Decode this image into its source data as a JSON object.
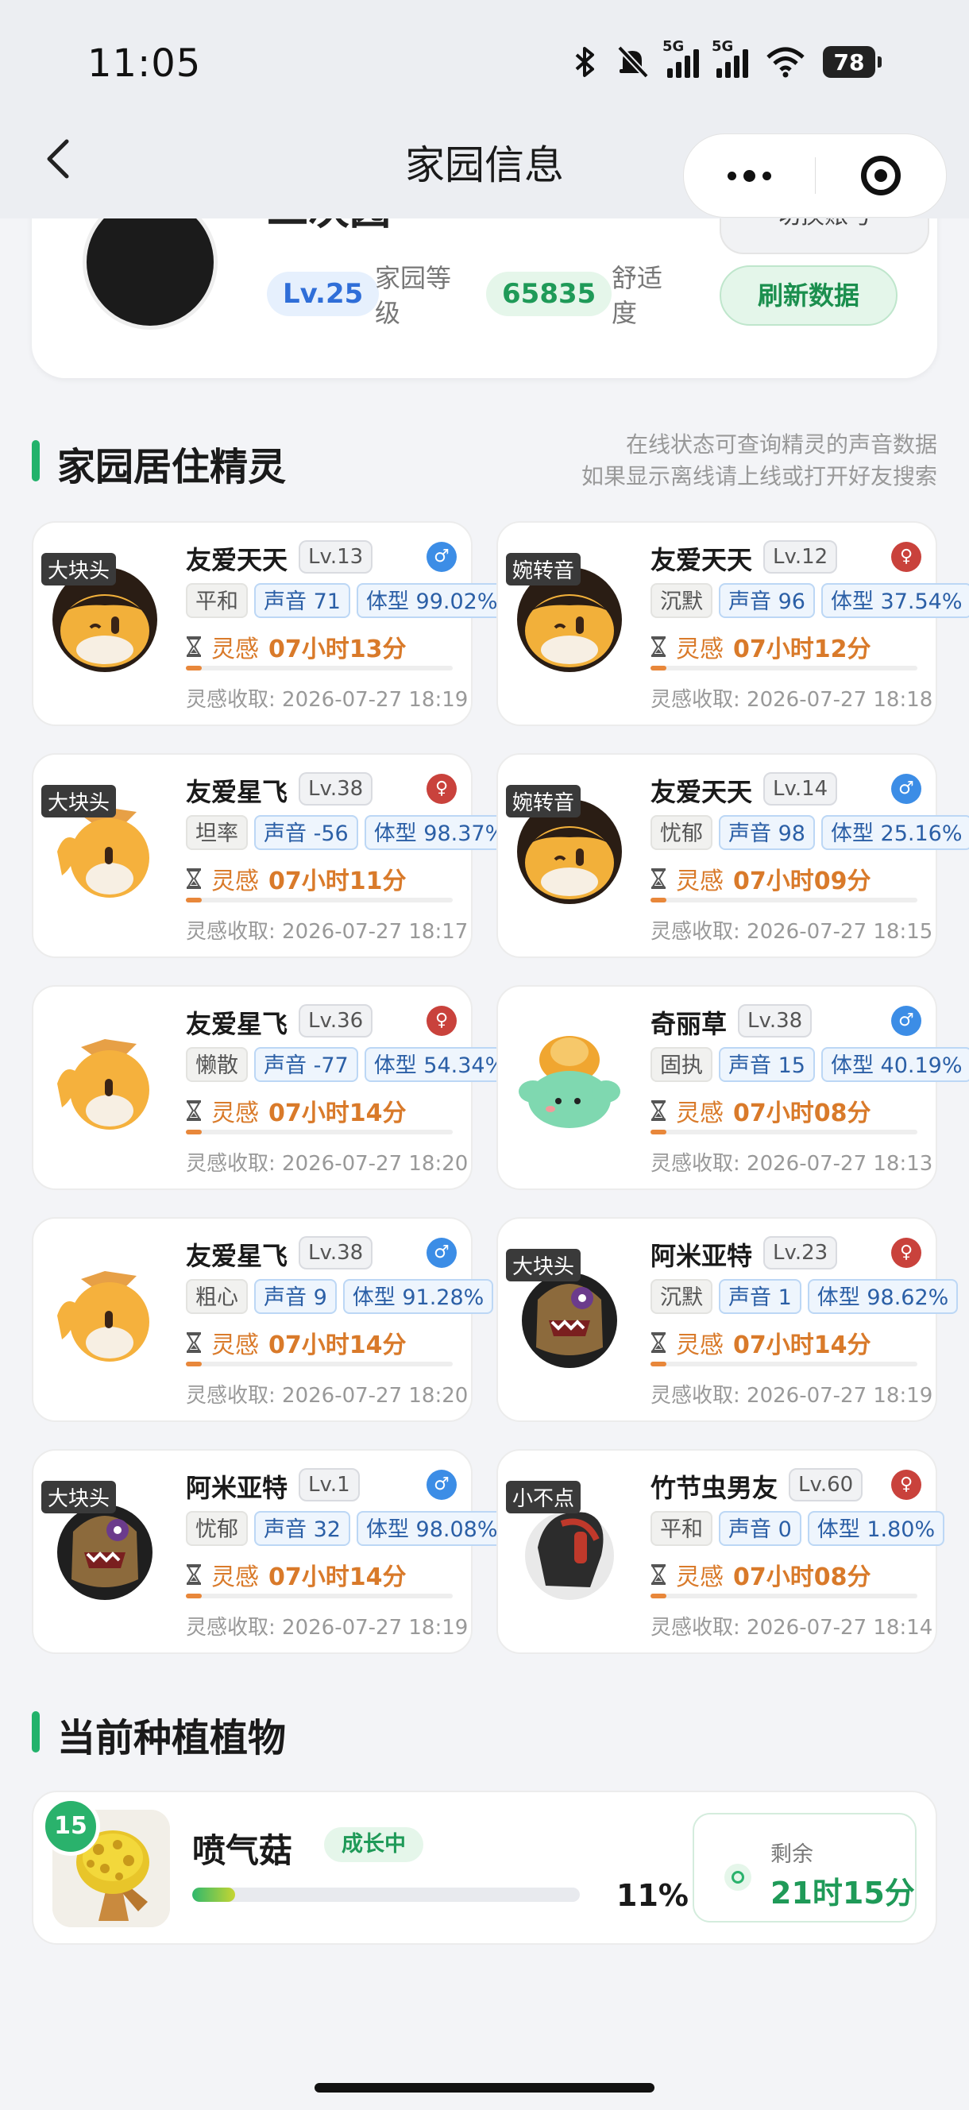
{
  "status_bar": {
    "time": "11:05",
    "net1": "5G",
    "net2": "5G",
    "battery": "78"
  },
  "nav": {
    "title": "家园信息",
    "back_icon": "chevron-left-icon",
    "more_icon": "more-dots-icon",
    "close_icon": "target-icon"
  },
  "profile": {
    "home_name": "二次园",
    "switch_label": "切换账号",
    "level": "Lv.25",
    "level_label": "家园等级",
    "comfort": "65835",
    "comfort_label": "舒适度",
    "refresh_label": "刷新数据"
  },
  "spirits_section": {
    "title": "家园居住精灵",
    "note_line1": "在线状态可查询精灵的声音数据",
    "note_line2": "如果显示离线请上线或打开好友搜索"
  },
  "spirits": [
    {
      "tag": "大块头",
      "name": "友爱天天",
      "lv": "Lv.13",
      "gender": "♂",
      "trait": "平和",
      "voice": "声音 71",
      "size": "体型 99.02%",
      "insp_label": "灵感",
      "insp_time": "07小时13分",
      "progress": 0.06,
      "collect": "灵感收取: 2026-07-27 18:19"
    },
    {
      "tag": "婉转音",
      "name": "友爱天天",
      "lv": "Lv.12",
      "gender": "♀",
      "trait": "沉默",
      "voice": "声音 96",
      "size": "体型 37.54%",
      "insp_label": "灵感",
      "insp_time": "07小时12分",
      "progress": 0.06,
      "collect": "灵感收取: 2026-07-27 18:18"
    },
    {
      "tag": "大块头",
      "name": "友爱星飞",
      "lv": "Lv.38",
      "gender": "♀",
      "trait": "坦率",
      "voice": "声音 -56",
      "size": "体型 98.37%",
      "insp_label": "灵感",
      "insp_time": "07小时11分",
      "progress": 0.06,
      "collect": "灵感收取: 2026-07-27 18:17"
    },
    {
      "tag": "婉转音",
      "name": "友爱天天",
      "lv": "Lv.14",
      "gender": "♂",
      "trait": "忧郁",
      "voice": "声音 98",
      "size": "体型 25.16%",
      "insp_label": "灵感",
      "insp_time": "07小时09分",
      "progress": 0.06,
      "collect": "灵感收取: 2026-07-27 18:15"
    },
    {
      "tag": "",
      "name": "友爱星飞",
      "lv": "Lv.36",
      "gender": "♀",
      "trait": "懒散",
      "voice": "声音 -77",
      "size": "体型 54.34%",
      "insp_label": "灵感",
      "insp_time": "07小时14分",
      "progress": 0.06,
      "collect": "灵感收取: 2026-07-27 18:20"
    },
    {
      "tag": "",
      "name": "奇丽草",
      "lv": "Lv.38",
      "gender": "♂",
      "trait": "固执",
      "voice": "声音 15",
      "size": "体型 40.19%",
      "insp_label": "灵感",
      "insp_time": "07小时08分",
      "progress": 0.06,
      "collect": "灵感收取: 2026-07-27 18:13"
    },
    {
      "tag": "",
      "name": "友爱星飞",
      "lv": "Lv.38",
      "gender": "♂",
      "trait": "粗心",
      "voice": "声音 9",
      "size": "体型 91.28%",
      "insp_label": "灵感",
      "insp_time": "07小时14分",
      "progress": 0.06,
      "collect": "灵感收取: 2026-07-27 18:20"
    },
    {
      "tag": "大块头",
      "name": "阿米亚特",
      "lv": "Lv.23",
      "gender": "♀",
      "trait": "沉默",
      "voice": "声音 1",
      "size": "体型 98.62%",
      "insp_label": "灵感",
      "insp_time": "07小时14分",
      "progress": 0.06,
      "collect": "灵感收取: 2026-07-27 18:19"
    },
    {
      "tag": "大块头",
      "name": "阿米亚特",
      "lv": "Lv.1",
      "gender": "♂",
      "trait": "忧郁",
      "voice": "声音 32",
      "size": "体型 98.08%",
      "insp_label": "灵感",
      "insp_time": "07小时14分",
      "progress": 0.06,
      "collect": "灵感收取: 2026-07-27 18:19"
    },
    {
      "tag": "小不点",
      "name": "竹节虫男友",
      "lv": "Lv.60",
      "gender": "♀",
      "trait": "平和",
      "voice": "声音 0",
      "size": "体型 1.80%",
      "insp_label": "灵感",
      "insp_time": "07小时08分",
      "progress": 0.06,
      "collect": "灵感收取: 2026-07-27 18:14"
    }
  ],
  "plant_section": {
    "title": "当前种植植物"
  },
  "plant": {
    "level": "15",
    "name": "喷气菇",
    "status": "成长中",
    "progress": 0.11,
    "percent": "11%",
    "remain_label": "剩余",
    "remain_value": "21时15分"
  },
  "colors": {
    "accent": "#22b26b",
    "male": "#3c8de6",
    "female": "#c9423c",
    "inspiration": "#d97a2a"
  }
}
